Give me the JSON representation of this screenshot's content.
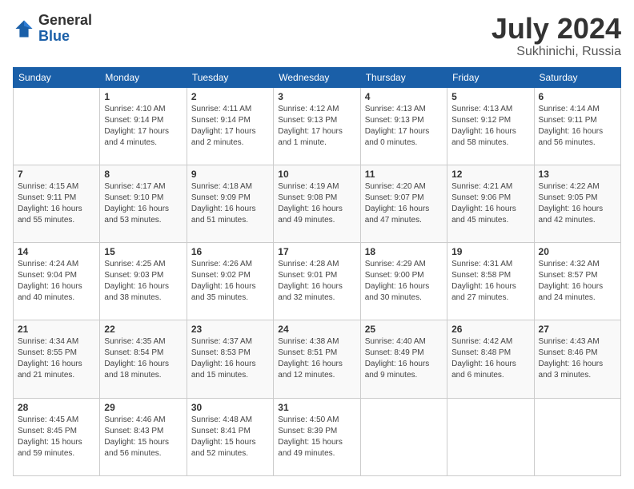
{
  "logo": {
    "general": "General",
    "blue": "Blue"
  },
  "title": {
    "month_year": "July 2024",
    "location": "Sukhinichi, Russia"
  },
  "weekdays": [
    "Sunday",
    "Monday",
    "Tuesday",
    "Wednesday",
    "Thursday",
    "Friday",
    "Saturday"
  ],
  "weeks": [
    [
      {
        "day": "",
        "sunrise": "",
        "sunset": "",
        "daylight": ""
      },
      {
        "day": "1",
        "sunrise": "Sunrise: 4:10 AM",
        "sunset": "Sunset: 9:14 PM",
        "daylight": "Daylight: 17 hours and 4 minutes."
      },
      {
        "day": "2",
        "sunrise": "Sunrise: 4:11 AM",
        "sunset": "Sunset: 9:14 PM",
        "daylight": "Daylight: 17 hours and 2 minutes."
      },
      {
        "day": "3",
        "sunrise": "Sunrise: 4:12 AM",
        "sunset": "Sunset: 9:13 PM",
        "daylight": "Daylight: 17 hours and 1 minute."
      },
      {
        "day": "4",
        "sunrise": "Sunrise: 4:13 AM",
        "sunset": "Sunset: 9:13 PM",
        "daylight": "Daylight: 17 hours and 0 minutes."
      },
      {
        "day": "5",
        "sunrise": "Sunrise: 4:13 AM",
        "sunset": "Sunset: 9:12 PM",
        "daylight": "Daylight: 16 hours and 58 minutes."
      },
      {
        "day": "6",
        "sunrise": "Sunrise: 4:14 AM",
        "sunset": "Sunset: 9:11 PM",
        "daylight": "Daylight: 16 hours and 56 minutes."
      }
    ],
    [
      {
        "day": "7",
        "sunrise": "Sunrise: 4:15 AM",
        "sunset": "Sunset: 9:11 PM",
        "daylight": "Daylight: 16 hours and 55 minutes."
      },
      {
        "day": "8",
        "sunrise": "Sunrise: 4:17 AM",
        "sunset": "Sunset: 9:10 PM",
        "daylight": "Daylight: 16 hours and 53 minutes."
      },
      {
        "day": "9",
        "sunrise": "Sunrise: 4:18 AM",
        "sunset": "Sunset: 9:09 PM",
        "daylight": "Daylight: 16 hours and 51 minutes."
      },
      {
        "day": "10",
        "sunrise": "Sunrise: 4:19 AM",
        "sunset": "Sunset: 9:08 PM",
        "daylight": "Daylight: 16 hours and 49 minutes."
      },
      {
        "day": "11",
        "sunrise": "Sunrise: 4:20 AM",
        "sunset": "Sunset: 9:07 PM",
        "daylight": "Daylight: 16 hours and 47 minutes."
      },
      {
        "day": "12",
        "sunrise": "Sunrise: 4:21 AM",
        "sunset": "Sunset: 9:06 PM",
        "daylight": "Daylight: 16 hours and 45 minutes."
      },
      {
        "day": "13",
        "sunrise": "Sunrise: 4:22 AM",
        "sunset": "Sunset: 9:05 PM",
        "daylight": "Daylight: 16 hours and 42 minutes."
      }
    ],
    [
      {
        "day": "14",
        "sunrise": "Sunrise: 4:24 AM",
        "sunset": "Sunset: 9:04 PM",
        "daylight": "Daylight: 16 hours and 40 minutes."
      },
      {
        "day": "15",
        "sunrise": "Sunrise: 4:25 AM",
        "sunset": "Sunset: 9:03 PM",
        "daylight": "Daylight: 16 hours and 38 minutes."
      },
      {
        "day": "16",
        "sunrise": "Sunrise: 4:26 AM",
        "sunset": "Sunset: 9:02 PM",
        "daylight": "Daylight: 16 hours and 35 minutes."
      },
      {
        "day": "17",
        "sunrise": "Sunrise: 4:28 AM",
        "sunset": "Sunset: 9:01 PM",
        "daylight": "Daylight: 16 hours and 32 minutes."
      },
      {
        "day": "18",
        "sunrise": "Sunrise: 4:29 AM",
        "sunset": "Sunset: 9:00 PM",
        "daylight": "Daylight: 16 hours and 30 minutes."
      },
      {
        "day": "19",
        "sunrise": "Sunrise: 4:31 AM",
        "sunset": "Sunset: 8:58 PM",
        "daylight": "Daylight: 16 hours and 27 minutes."
      },
      {
        "day": "20",
        "sunrise": "Sunrise: 4:32 AM",
        "sunset": "Sunset: 8:57 PM",
        "daylight": "Daylight: 16 hours and 24 minutes."
      }
    ],
    [
      {
        "day": "21",
        "sunrise": "Sunrise: 4:34 AM",
        "sunset": "Sunset: 8:55 PM",
        "daylight": "Daylight: 16 hours and 21 minutes."
      },
      {
        "day": "22",
        "sunrise": "Sunrise: 4:35 AM",
        "sunset": "Sunset: 8:54 PM",
        "daylight": "Daylight: 16 hours and 18 minutes."
      },
      {
        "day": "23",
        "sunrise": "Sunrise: 4:37 AM",
        "sunset": "Sunset: 8:53 PM",
        "daylight": "Daylight: 16 hours and 15 minutes."
      },
      {
        "day": "24",
        "sunrise": "Sunrise: 4:38 AM",
        "sunset": "Sunset: 8:51 PM",
        "daylight": "Daylight: 16 hours and 12 minutes."
      },
      {
        "day": "25",
        "sunrise": "Sunrise: 4:40 AM",
        "sunset": "Sunset: 8:49 PM",
        "daylight": "Daylight: 16 hours and 9 minutes."
      },
      {
        "day": "26",
        "sunrise": "Sunrise: 4:42 AM",
        "sunset": "Sunset: 8:48 PM",
        "daylight": "Daylight: 16 hours and 6 minutes."
      },
      {
        "day": "27",
        "sunrise": "Sunrise: 4:43 AM",
        "sunset": "Sunset: 8:46 PM",
        "daylight": "Daylight: 16 hours and 3 minutes."
      }
    ],
    [
      {
        "day": "28",
        "sunrise": "Sunrise: 4:45 AM",
        "sunset": "Sunset: 8:45 PM",
        "daylight": "Daylight: 15 hours and 59 minutes."
      },
      {
        "day": "29",
        "sunrise": "Sunrise: 4:46 AM",
        "sunset": "Sunset: 8:43 PM",
        "daylight": "Daylight: 15 hours and 56 minutes."
      },
      {
        "day": "30",
        "sunrise": "Sunrise: 4:48 AM",
        "sunset": "Sunset: 8:41 PM",
        "daylight": "Daylight: 15 hours and 52 minutes."
      },
      {
        "day": "31",
        "sunrise": "Sunrise: 4:50 AM",
        "sunset": "Sunset: 8:39 PM",
        "daylight": "Daylight: 15 hours and 49 minutes."
      },
      {
        "day": "",
        "sunrise": "",
        "sunset": "",
        "daylight": ""
      },
      {
        "day": "",
        "sunrise": "",
        "sunset": "",
        "daylight": ""
      },
      {
        "day": "",
        "sunrise": "",
        "sunset": "",
        "daylight": ""
      }
    ]
  ]
}
